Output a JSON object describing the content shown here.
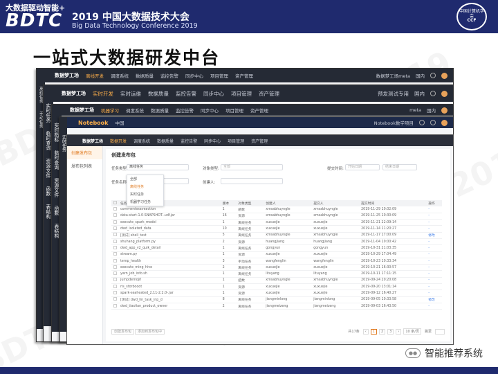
{
  "header": {
    "line1": "大数据驱动智能+",
    "logo": "BDTC",
    "line2": "2019 中国大数据技术大会",
    "line3": "Big Data Technology Conference 2019",
    "seal_top": "中国计算机学会",
    "seal_bottom": "CCF"
  },
  "slide_title": "一站式大数据研发中台",
  "watermark": "BDTC 2019",
  "footer_brand": "智能推荐系统",
  "frames": {
    "f1": {
      "brand": "数据梦工场",
      "tabs": [
        "离线开发",
        "调度系统",
        "数据质量",
        "监控告警",
        "同步中心",
        "项目管理",
        "资产管理"
      ],
      "right": "数据梦工场meta",
      "region": "国内",
      "side": [
        "离线任务",
        "手动任务"
      ]
    },
    "f2": {
      "brand": "数据梦工场",
      "sub": "国内",
      "tabs": [
        "实时开发",
        "实时运维",
        "数据质量",
        "监控告警",
        "同步中心",
        "项目管理",
        "资产管理"
      ],
      "right": "预发测试专用",
      "region": "国内",
      "side": [
        "实时任务",
        "临时查询",
        "资源文件",
        "函数",
        "表结构"
      ]
    },
    "f3": {
      "brand": "数据梦工场",
      "tabs": [
        "机器学习",
        "调度系统",
        "数据质量",
        "监控告警",
        "同步中心",
        "项目管理",
        "资产管理"
      ],
      "right": "meta",
      "region": "国内",
      "side": [
        "实时指标",
        "临时查询",
        "资源文件",
        "函数",
        "表结构"
      ]
    },
    "f4": {
      "left": "Notebook",
      "region": "中国",
      "right": "Notebook数学项目",
      "side": [
        "实时任务",
        "临时查询",
        "资源文件",
        "函数",
        "表结构"
      ]
    }
  },
  "main": {
    "brand": "数据梦工场",
    "sub": "国内",
    "tabs": [
      "数据开发",
      "调度系统",
      "数据质量",
      "监控告警",
      "同步中心",
      "项目管理",
      "资产管理"
    ],
    "side": [
      "创建发布包",
      "发布包列表"
    ],
    "page_title": "创建发布包",
    "form": {
      "task_type_label": "任务类型:",
      "task_type_value": "离线任务",
      "task_name_label": "任务名称:",
      "object_type_label": "对象类型:",
      "object_type_placeholder": "全部",
      "creator_label": "创建人:",
      "submit_time_label": "提交时间:",
      "submit_time_placeholder": "开始日期",
      "end_placeholder": "结束日期"
    },
    "dropdown": [
      "全部",
      "离线任务",
      "实时任务",
      "机器学习任务"
    ],
    "columns": [
      "任务名称",
      "版本",
      "对象类型",
      "创建人",
      "提交人",
      "提交时间",
      "操作"
    ],
    "rows": [
      [
        "commentssaveaction",
        "1",
        "函数",
        "xmsabhuyngle",
        "xmsabhuyngle",
        "2019-11-29 10:02:09",
        "-"
      ],
      [
        "data-start-1.0-SNAPSHOT-.udf.jar",
        "16",
        "资源",
        "xmsabhuyngle",
        "xmsabhuyngle",
        "2019-11-25 10:30:09",
        "-"
      ],
      [
        "execute_spark_model",
        "1",
        "离线任务",
        "xuxuejie",
        "xuxuejie",
        "2019-11-21 22:09:14",
        "-"
      ],
      [
        "dwd_isolated_data",
        "10",
        "离线任务",
        "xuxuejie",
        "xuxuejie",
        "2019-11-14 11:20:27",
        "-"
      ],
      [
        "[测试] shell_test",
        "5",
        "离线任务",
        "xmsabhuyngle",
        "xmsabhuyngle",
        "2019-11-17 17:00:09",
        "修改"
      ],
      [
        "shuhang_platform.py",
        "2",
        "资源",
        "huangjiang",
        "huangjiang",
        "2019-11-04 10:00:42",
        "-"
      ],
      [
        "dwd_app_v2_quik_detail",
        "1",
        "离线任务",
        "gongyun",
        "gongyun",
        "2019-10-31 21:03:35",
        "-"
      ],
      [
        "stream.py",
        "1",
        "资源",
        "xuxuejie",
        "xuxuejie",
        "2019-10-29 17:04:49",
        "-"
      ],
      [
        "temp_health",
        "3",
        "手动任务",
        "wangfenglin",
        "wangfenglin",
        "2019-10-23 10:33:34",
        "-"
      ],
      [
        "execute_ming_hive",
        "2",
        "离线任务",
        "xuxuejie",
        "xuxuejie",
        "2019-10-21 16:30:57",
        "-"
      ],
      [
        "yarn_job_info.sh",
        "1",
        "离线任务",
        "lituyang",
        "lituyang",
        "2019-10-11 17:11:15",
        "-"
      ],
      [
        "jumpdemojrl",
        "1",
        "函数",
        "xmsabhuyngle",
        "xmsabhuyngle",
        "2019-09-24 20:20:08",
        "-"
      ],
      [
        "ris_storbooot",
        "1",
        "资源",
        "xuxuejie",
        "xuxuejie",
        "2019-09-20 13:01:14",
        "-"
      ],
      [
        "spark-seaheated_2.11-2.2.0-.jar",
        "1",
        "资源",
        "xuxuejie",
        "xuxuejie",
        "2019-09-12 16:40:27",
        "-"
      ],
      [
        "[测试] dwd_lin_task_inp_d",
        "8",
        "离线任务",
        "jiangminlong",
        "jiangminlong",
        "2019-09-05 10:33:58",
        "修改"
      ],
      [
        "dwd_tiaolian_product_owner",
        "2",
        "离线任务",
        "jiangmeizeng",
        "jiangmeizeng",
        "2019-09-03 16:43:50",
        "-"
      ]
    ],
    "pager": {
      "total": "共17条",
      "pages": [
        "1",
        "2",
        "3"
      ],
      "size": "10 条/页",
      "jump": "跳至"
    },
    "bottom_buttons": [
      "创建发布包",
      "添加到发布包中"
    ]
  }
}
